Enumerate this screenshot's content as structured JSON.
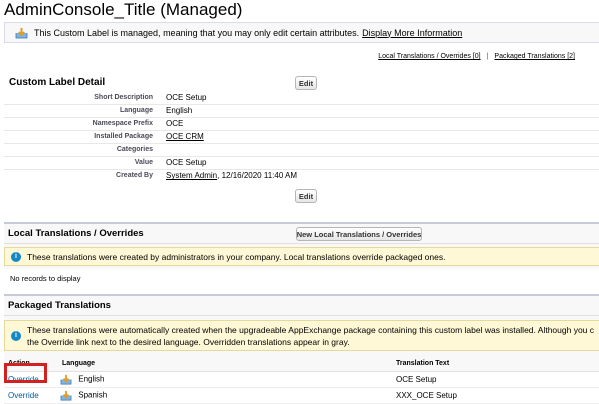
{
  "page": {
    "title": "AdminConsole_Title (Managed)"
  },
  "managed_note": {
    "text": "This Custom Label is managed, meaning that you may only edit certain attributes.",
    "link": "Display More Information",
    "icon": "package-icon"
  },
  "top_links": {
    "local": "Local Translations / Overrides",
    "local_count": "[0]",
    "separator": "|",
    "packaged": "Packaged Translations",
    "packaged_count": "[2]"
  },
  "detail": {
    "title": "Custom Label Detail",
    "edit_label": "Edit",
    "rows": [
      {
        "label": "Short Description",
        "value": "OCE Setup"
      },
      {
        "label": "Language",
        "value": "English"
      },
      {
        "label": "Namespace Prefix",
        "value": "OCE"
      },
      {
        "label": "Installed Package",
        "value": "OCE CRM"
      },
      {
        "label": "Categories",
        "value": ""
      },
      {
        "label": "Value",
        "value": "OCE Setup"
      }
    ],
    "created_by_label": "Created By",
    "created_by_user": "System Admin",
    "created_by_date": ", 12/16/2020 11:40 AM"
  },
  "local_translations": {
    "title": "Local Translations / Overrides",
    "new_button": "New Local Translations / Overrides",
    "info": "These translations were created by administrators in your company. Local translations override packaged ones.",
    "empty": "No records to display"
  },
  "packaged_translations": {
    "title": "Packaged Translations",
    "info_line1": "These translations were automatically created when the upgradeable AppExchange package containing this custom label was installed. Although you c",
    "info_line2": "the Override link next to the desired language. Overridden translations appear in gray.",
    "columns": {
      "action": "Action",
      "language": "Language",
      "translation": "Translation Text"
    },
    "rows": [
      {
        "action": "Override",
        "language": "English",
        "translation": "OCE Setup"
      },
      {
        "action": "Override",
        "language": "Spanish",
        "translation": "XXX_OCE Setup"
      }
    ]
  },
  "colors": {
    "link": "#015ba7",
    "info_icon": "#1589c7",
    "highlight": "#d32020",
    "info_bg": "#fff8d6"
  }
}
